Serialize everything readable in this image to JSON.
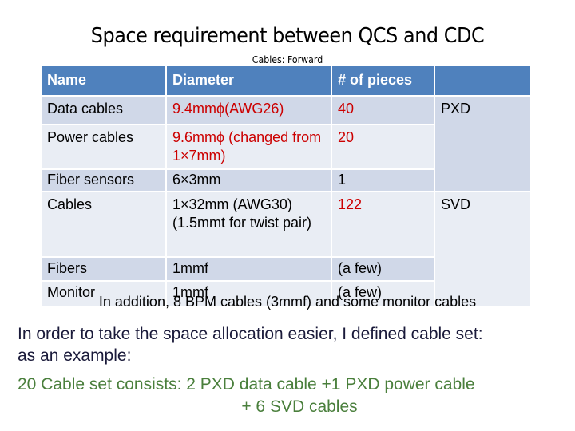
{
  "title": "Space requirement between QCS and CDC",
  "subtitle": "Cables: Forward",
  "table": {
    "headers": [
      "Name",
      "Diameter",
      "# of pieces",
      ""
    ],
    "rows": [
      {
        "name": "Data cables",
        "diameter": "9.4mmϕ(AWG26)",
        "pieces": "40",
        "group": "PXD",
        "highlight": true
      },
      {
        "name": "Power cables",
        "diameter": "9.6mmϕ (changed from 1×7mm)",
        "pieces": "20",
        "group": "",
        "highlight": true
      },
      {
        "name": "Fiber sensors",
        "diameter": "6×3mm",
        "pieces": "1",
        "group": "",
        "highlight": false
      },
      {
        "name": "Cables",
        "diameter": "1×32mm (AWG30) (1.5mmt for twist pair)",
        "pieces": "122",
        "group": "SVD",
        "highlight": false,
        "pieces_highlight": true
      },
      {
        "name": "Fibers",
        "diameter": "1mmf",
        "pieces": "(a few)",
        "group": "",
        "highlight": false
      },
      {
        "name": "Monitor",
        "diameter": "1mmf",
        "pieces": "(a few)",
        "group": "",
        "highlight": false
      }
    ],
    "groups": [
      "PXD",
      "SVD"
    ]
  },
  "overlay_note": "In addition, 8 BPM cables (3mmf) and some monitor cables",
  "body": {
    "line1": "In order to take the space allocation easier, I defined cable set:",
    "line2": "as an example:"
  },
  "green": {
    "line1": "20 Cable set consists: 2  PXD data cable +1 PXD power cable",
    "line2": "+ 6 SVD cables"
  },
  "colors": {
    "header_bg": "#4f81bd",
    "row_odd": "#d0d8e8",
    "row_even": "#e9edf4",
    "highlight_red": "#cc0000",
    "example_green": "#4a7f3c"
  }
}
